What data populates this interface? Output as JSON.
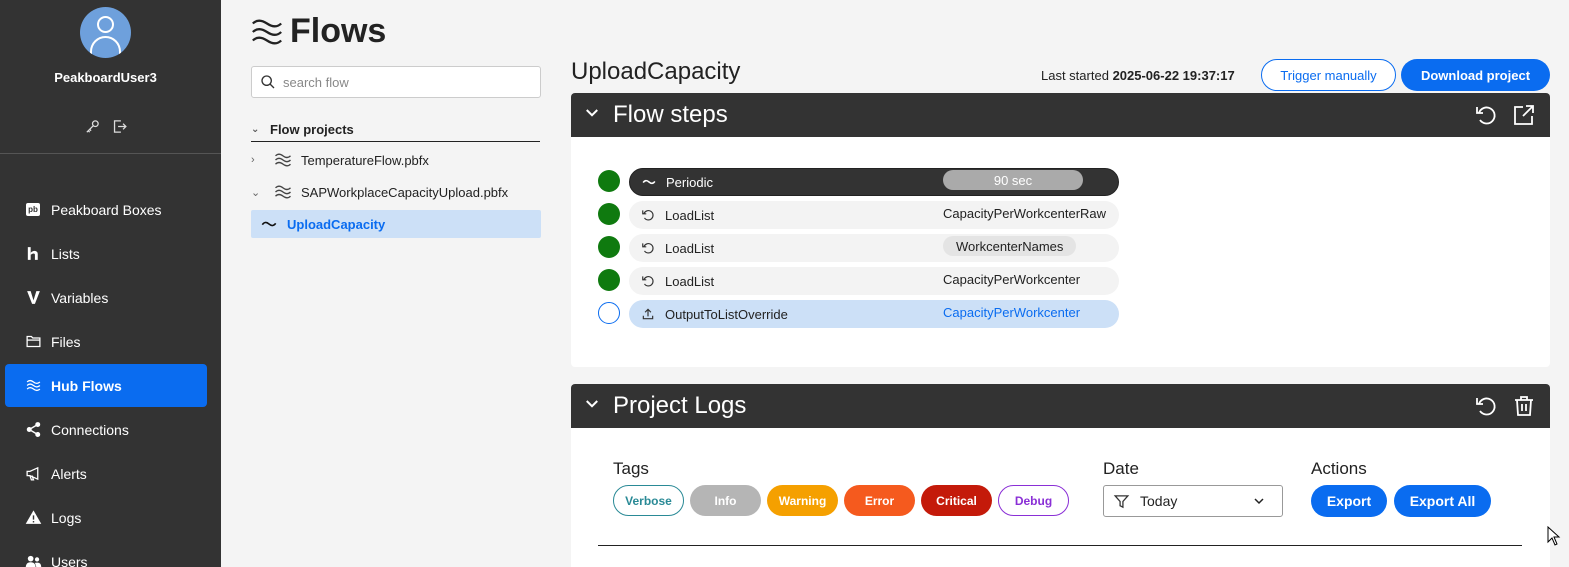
{
  "sidebar": {
    "username": "PeakboardUser3",
    "items": [
      {
        "label": "Peakboard Boxes",
        "icon": "pb-icon"
      },
      {
        "label": "Lists",
        "icon": "lists-icon"
      },
      {
        "label": "Variables",
        "icon": "variables-icon"
      },
      {
        "label": "Files",
        "icon": "folder-icon"
      },
      {
        "label": "Hub Flows",
        "icon": "flows-icon",
        "active": true
      },
      {
        "label": "Connections",
        "icon": "share-icon"
      },
      {
        "label": "Alerts",
        "icon": "megaphone-icon"
      },
      {
        "label": "Logs",
        "icon": "warning-icon"
      },
      {
        "label": "Users",
        "icon": "users-icon"
      }
    ],
    "pb_badge": "pb"
  },
  "page": {
    "title": "Flows"
  },
  "search": {
    "placeholder": "search flow"
  },
  "tree": {
    "header": "Flow projects",
    "projects": [
      "TemperatureFlow.pbfx",
      "SAPWorkplaceCapacityUpload.pbfx"
    ],
    "selected": "UploadCapacity"
  },
  "flow": {
    "title": "UploadCapacity",
    "last_started_label": "Last started",
    "last_started_value": "2025-06-22 19:37:17",
    "trigger_label": "Trigger manually",
    "download_label": "Download project"
  },
  "flow_steps": {
    "title": "Flow steps",
    "steps": [
      {
        "name": "Periodic",
        "value": "90 sec",
        "status": "done"
      },
      {
        "name": "LoadList",
        "value": "CapacityPerWorkcenterRaw",
        "status": "done"
      },
      {
        "name": "LoadList",
        "value": "WorkcenterNames",
        "status": "done"
      },
      {
        "name": "LoadList",
        "value": "CapacityPerWorkcenter",
        "status": "done"
      },
      {
        "name": "OutputToListOverride",
        "value": "CapacityPerWorkcenter",
        "status": "pending"
      }
    ]
  },
  "project_logs": {
    "title": "Project Logs",
    "tags_label": "Tags",
    "tags": [
      {
        "label": "Verbose",
        "color": "#2a8a96"
      },
      {
        "label": "Info",
        "color": "#b5b5b5"
      },
      {
        "label": "Warning",
        "color": "#f5a000"
      },
      {
        "label": "Error",
        "color": "#f55a1e"
      },
      {
        "label": "Critical",
        "color": "#c41a0a"
      },
      {
        "label": "Debug",
        "color": "#8a2fd6"
      }
    ],
    "date_label": "Date",
    "date_value": "Today",
    "actions_label": "Actions",
    "export_label": "Export",
    "export_all_label": "Export All"
  },
  "colors": {
    "accent": "#0a6cf0",
    "sidebar_bg": "#333333",
    "success": "#0f7a0f"
  }
}
